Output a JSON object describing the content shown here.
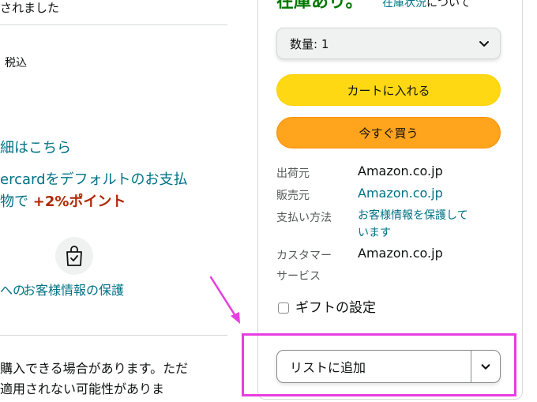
{
  "left": {
    "top_text": "されました",
    "tax_label": "税込",
    "details_link": "細はこちら",
    "card_promo_line1": "ercardをデフォルトのお支払",
    "card_promo_line2_prefix": "物で ",
    "card_promo_points": "+2%ポイント",
    "secure_left": "への",
    "secure_center": "お客様情報の保護",
    "bottom_line1": "購入できる場合があります。ただ",
    "bottom_line2": "適用されない可能性がありま"
  },
  "buybox": {
    "stock_status": "在庫あり。",
    "stock_link": "在庫状況",
    "stock_link_suffix": "について",
    "qty_label": "数量: 1",
    "add_to_cart": "カートに入れる",
    "buy_now": "今すぐ買う",
    "info": {
      "shipper_label": "出荷元",
      "shipper_value": "Amazon.co.jp",
      "seller_label": "販売元",
      "seller_value": "Amazon.co.jp",
      "payment_label": "支払い方法",
      "payment_value_line1": "お客様情報を保護して",
      "payment_value_line2": "います",
      "cs_label_line1": "カスタマー",
      "cs_label_line2": "サービス",
      "cs_value": "Amazon.co.jp"
    },
    "gift_label": "ギフトの設定",
    "add_to_list": "リストに追加"
  },
  "colors": {
    "link": "#007185",
    "stock_green": "#007600",
    "cart_yellow": "#FFD814",
    "buy_orange": "#FFA41C",
    "points_red": "#B12704",
    "annotation_magenta": "#E83DDF"
  },
  "icons": {
    "bag": "shopping-bag-check-icon",
    "qty_chevron": "chevron-down-icon",
    "list_chevron": "chevron-down-icon",
    "annotation_arrow": "arrow-icon"
  }
}
